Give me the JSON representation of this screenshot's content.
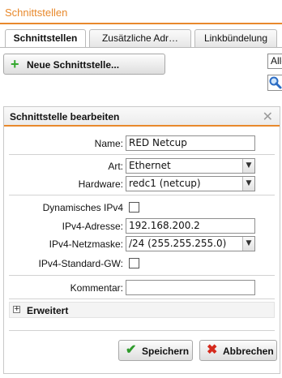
{
  "app": {
    "title": "Schnittstellen"
  },
  "tabs": [
    {
      "label": "Schnittstellen",
      "active": true
    },
    {
      "label": "Zusätzliche Adr…",
      "active": false
    },
    {
      "label": "Linkbündelung",
      "active": false
    }
  ],
  "toolbar": {
    "new_button_label": "Neue Schnittstelle...",
    "filter_value": "Alle",
    "search_icon": "search-icon"
  },
  "panel": {
    "title": "Schnittstelle bearbeiten",
    "close_icon": "close-icon",
    "name": {
      "label": "Name:",
      "value": "RED Netcup"
    },
    "type": {
      "label": "Art:",
      "value": "Ethernet"
    },
    "hardware": {
      "label": "Hardware:",
      "value": "redc1 (netcup)"
    },
    "dynamic_ipv4": {
      "label": "Dynamisches IPv4",
      "checked": false
    },
    "ipv4_address": {
      "label": "IPv4-Adresse:",
      "value": "192.168.200.2"
    },
    "ipv4_netmask": {
      "label": "IPv4-Netzmaske:",
      "value": "/24 (255.255.255.0)"
    },
    "ipv4_default_gw": {
      "label": "IPv4-Standard-GW:",
      "checked": false
    },
    "comment": {
      "label": "Kommentar:",
      "value": ""
    },
    "advanced": {
      "label": "Erweitert",
      "icon": "expand-plus-icon"
    },
    "save_label": "Speichern",
    "cancel_label": "Abbrechen"
  },
  "colors": {
    "accent": "#e8892c",
    "save_icon": "#2e9a2b",
    "cancel_icon": "#d52a1d",
    "add_icon": "#35a82f"
  }
}
